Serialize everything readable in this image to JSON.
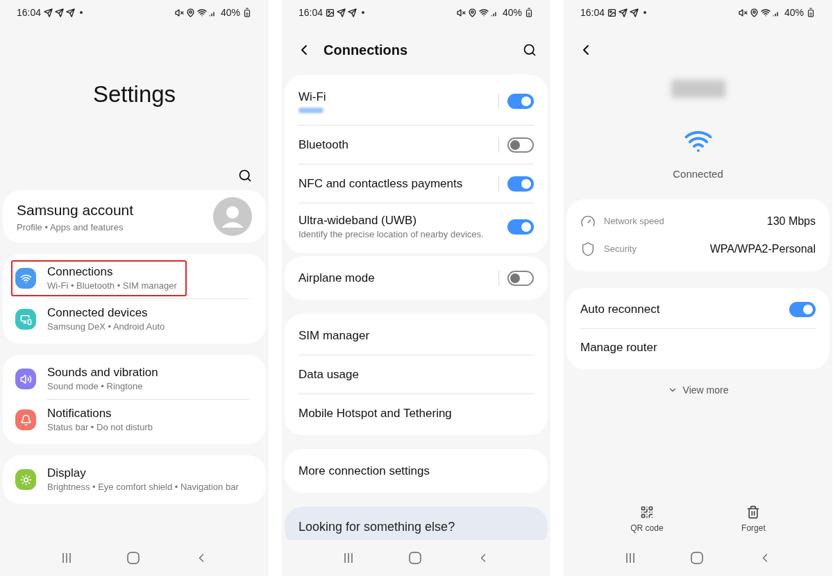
{
  "screens": [
    {
      "kind": "settings",
      "status_bar": {
        "time": "16:04",
        "battery": "40%"
      },
      "title": "Settings",
      "account": {
        "name": "Samsung account",
        "subtitle": "Profile  •  Apps and features"
      },
      "groups": [
        [
          {
            "kind": "wifi",
            "label": "Connections",
            "subtitle": "Wi-Fi  •  Bluetooth  •  SIM manager",
            "color": "#4a9bf0",
            "highlighted": true
          },
          {
            "kind": "devices",
            "label": "Connected devices",
            "subtitle": "Samsung DeX  •  Android Auto",
            "color": "#3cc4c0",
            "highlighted": false
          }
        ],
        [
          {
            "kind": "sound",
            "label": "Sounds and vibration",
            "subtitle": "Sound mode  •  Ringtone",
            "color": "#8a7cf0",
            "highlighted": false
          },
          {
            "kind": "bell",
            "label": "Notifications",
            "subtitle": "Status bar  •  Do not disturb",
            "color": "#f2736a",
            "highlighted": false
          }
        ],
        [
          {
            "kind": "sun",
            "label": "Display",
            "subtitle": "Brightness  •  Eye comfort shield  •  Navigation bar",
            "color": "#8cc63f",
            "highlighted": false
          }
        ]
      ]
    },
    {
      "kind": "connections",
      "status_bar": {
        "time": "16:04",
        "battery": "40%"
      },
      "title": "Connections",
      "groups": [
        [
          {
            "kind": "toggle",
            "label": "Wi-Fi",
            "blurred_subtitle": true,
            "on": true,
            "divider": true
          },
          {
            "kind": "toggle",
            "label": "Bluetooth",
            "on": false,
            "divider": true
          },
          {
            "kind": "toggle",
            "label": "NFC and contactless payments",
            "on": true,
            "divider": true
          },
          {
            "kind": "toggle",
            "label": "Ultra-wideband (UWB)",
            "subtitle": "Identify the precise location of nearby devices.",
            "on": true,
            "divider": false
          }
        ],
        [
          {
            "kind": "toggle",
            "label": "Airplane mode",
            "on": false,
            "divider": true
          }
        ],
        [
          {
            "kind": "link",
            "label": "SIM manager"
          },
          {
            "kind": "link",
            "label": "Data usage"
          },
          {
            "kind": "link",
            "label": "Mobile Hotspot and Tethering"
          }
        ],
        [
          {
            "kind": "link",
            "label": "More connection settings"
          }
        ]
      ],
      "suggestion": "Looking for something else?"
    },
    {
      "kind": "wifi_detail",
      "status_bar": {
        "time": "16:04",
        "battery": "40%"
      },
      "name_blurred": true,
      "status": "Connected",
      "info": [
        {
          "kind": "speed",
          "label": "Network speed",
          "value": "130 Mbps"
        },
        {
          "kind": "security",
          "label": "Security",
          "value": "WPA/WPA2-Personal"
        }
      ],
      "options": [
        {
          "kind": "toggle",
          "label": "Auto reconnect",
          "on": true
        },
        {
          "kind": "link",
          "label": "Manage router"
        }
      ],
      "view_more": "View more",
      "actions": [
        {
          "kind": "qr",
          "label": "QR code"
        },
        {
          "kind": "delete",
          "label": "Forget"
        }
      ]
    }
  ]
}
